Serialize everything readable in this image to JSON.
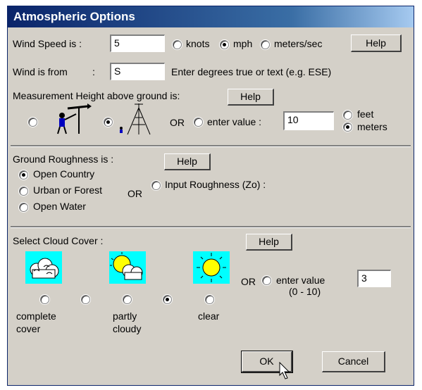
{
  "window": {
    "title": "Atmospheric Options"
  },
  "wind": {
    "speed_label": "Wind Speed is :",
    "speed_value": "5",
    "units": [
      {
        "label": "knots",
        "selected": false
      },
      {
        "label": "mph",
        "selected": true
      },
      {
        "label": "meters/sec",
        "selected": false
      }
    ],
    "help": "Help",
    "from_label": "Wind is from",
    "from_colon": ":",
    "from_value": "S",
    "from_hint": "Enter degrees true or text (e.g. ESE)"
  },
  "height": {
    "label": "Measurement Height above ground is:",
    "help": "Help",
    "or": "OR",
    "enter_label": "enter value :",
    "value": "10",
    "units": [
      {
        "label": "feet",
        "selected": false
      },
      {
        "label": "meters",
        "selected": true
      }
    ],
    "person_selected": false,
    "tower_selected": true,
    "enter_selected": false
  },
  "roughness": {
    "label": "Ground Roughness is :",
    "help": "Help",
    "options": [
      {
        "label": "Open Country",
        "selected": true
      },
      {
        "label": "Urban or Forest",
        "selected": false
      },
      {
        "label": "Open Water",
        "selected": false
      }
    ],
    "or": "OR",
    "input_label": "Input Roughness (Zo) :",
    "input_selected": false
  },
  "cloud": {
    "label": "Select Cloud Cover :",
    "help": "Help",
    "or": "OR",
    "enter_label": "enter value",
    "range": "(0 - 10)",
    "value": "3",
    "selected_index": 3,
    "labels": {
      "complete_1": "complete",
      "complete_2": "cover",
      "partly_1": "partly",
      "partly_2": "cloudy",
      "clear": "clear"
    }
  },
  "buttons": {
    "ok": "OK",
    "cancel": "Cancel"
  },
  "colors": {
    "title_start": "#0a246a",
    "title_end": "#a6caf0",
    "dialog_bg": "#d4d0c8",
    "icon_sky": "#00ffff",
    "sun": "#ffff00"
  }
}
